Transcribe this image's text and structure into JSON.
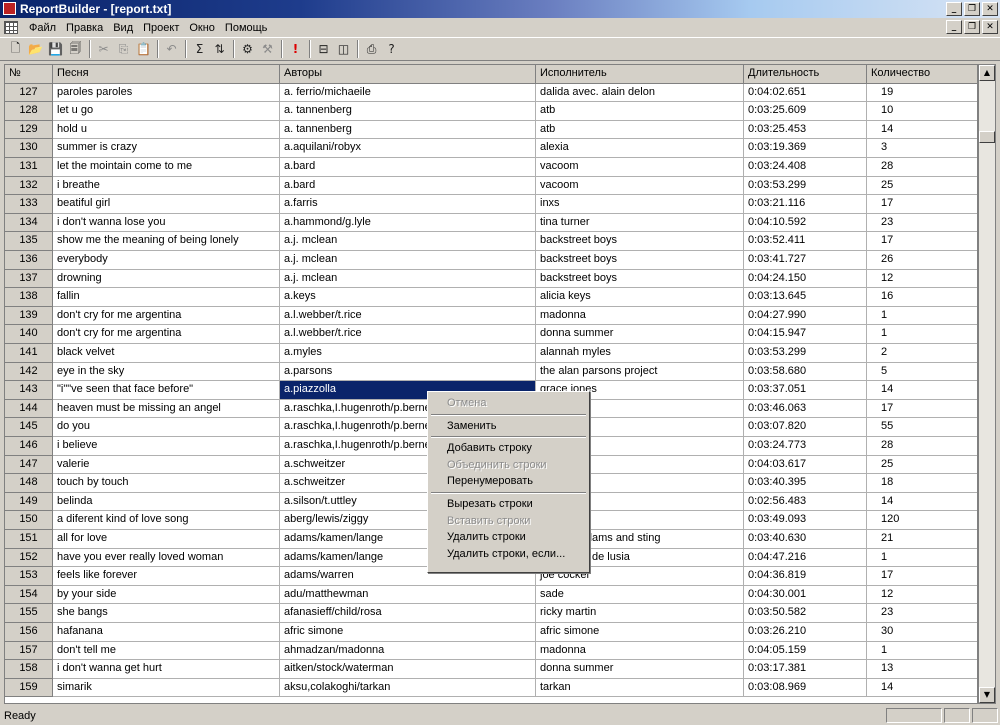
{
  "window": {
    "title": "ReportBuilder - [report.txt]"
  },
  "menu": [
    "Файл",
    "Правка",
    "Вид",
    "Проект",
    "Окно",
    "Помощь"
  ],
  "toolbar": [
    {
      "icon": "new-icon",
      "glyph": "🗋"
    },
    {
      "icon": "open-icon",
      "glyph": "📂"
    },
    {
      "icon": "save-icon",
      "glyph": "💾"
    },
    {
      "icon": "save-all-icon",
      "glyph": "🗐"
    },
    {
      "sep": true
    },
    {
      "icon": "cut-icon",
      "glyph": "✂",
      "disabled": true
    },
    {
      "icon": "copy-icon",
      "glyph": "⎘",
      "disabled": true
    },
    {
      "icon": "paste-icon",
      "glyph": "📋",
      "disabled": true
    },
    {
      "sep": true
    },
    {
      "icon": "undo-icon",
      "glyph": "↶",
      "disabled": true
    },
    {
      "sep": true
    },
    {
      "icon": "sum-icon",
      "glyph": "Σ"
    },
    {
      "icon": "sort-icon",
      "glyph": "⇅"
    },
    {
      "sep": true
    },
    {
      "icon": "filter-icon",
      "glyph": "⚙"
    },
    {
      "icon": "tools-icon",
      "glyph": "⚒",
      "disabled": true
    },
    {
      "sep": true
    },
    {
      "icon": "alert-icon",
      "glyph": "!",
      "red": true
    },
    {
      "sep": true
    },
    {
      "icon": "split-horizontal-icon",
      "glyph": "⊟"
    },
    {
      "icon": "split-vertical-icon",
      "glyph": "◫"
    },
    {
      "sep": true
    },
    {
      "icon": "print-icon",
      "glyph": "⎙"
    },
    {
      "icon": "help-icon",
      "glyph": "?"
    }
  ],
  "grid": {
    "headers": [
      "№",
      "Песня",
      "Авторы",
      "Исполнитель",
      "Длительность",
      "Количество"
    ],
    "rows": [
      [
        "127",
        "paroles paroles",
        "a. ferrio/michaeile",
        "dalida avec. alain delon",
        "0:04:02.651",
        "19"
      ],
      [
        "128",
        "let u go",
        "a. tannenberg",
        "atb",
        "0:03:25.609",
        "10"
      ],
      [
        "129",
        "hold u",
        "a. tannenberg",
        "atb",
        "0:03:25.453",
        "14"
      ],
      [
        "130",
        "summer is crazy",
        "a.aquilani/robyx",
        "alexia",
        "0:03:19.369",
        "3"
      ],
      [
        "131",
        "let the mointain come to me",
        "a.bard",
        "vacoom",
        "0:03:24.408",
        "28"
      ],
      [
        "132",
        "i breathe",
        "a.bard",
        "vacoom",
        "0:03:53.299",
        "25"
      ],
      [
        "133",
        "beatiful girl",
        "a.farris",
        "inxs",
        "0:03:21.116",
        "17"
      ],
      [
        "134",
        "i don't wanna lose you",
        "a.hammond/g.lyle",
        "tina turner",
        "0:04:10.592",
        "23"
      ],
      [
        "135",
        "show me the meaning of being lonely",
        "a.j. mclean",
        "backstreet boys",
        "0:03:52.411",
        "17"
      ],
      [
        "136",
        "everybody",
        "a.j. mclean",
        "backstreet boys",
        "0:03:41.727",
        "26"
      ],
      [
        "137",
        "drowning",
        "a.j. mclean",
        "backstreet boys",
        "0:04:24.150",
        "12"
      ],
      [
        "138",
        "fallin",
        "a.keys",
        "alicia keys",
        "0:03:13.645",
        "16"
      ],
      [
        "139",
        "don't cry for me argentina",
        "a.l.webber/t.rice",
        "madonna",
        "0:04:27.990",
        "1"
      ],
      [
        "140",
        "don't cry for me argentina",
        "a.l.webber/t.rice",
        "donna summer",
        "0:04:15.947",
        "1"
      ],
      [
        "141",
        "black velvet",
        "a.myles",
        "alannah myles",
        "0:03:53.299",
        "2"
      ],
      [
        "142",
        "eye in the sky",
        "a.parsons",
        "the alan parsons project",
        "0:03:58.680",
        "5"
      ],
      [
        "143",
        "\"i\"\"ve seen that face before\"",
        "a.piazzolla",
        "grace jones",
        "0:03:37.051",
        "14"
      ],
      [
        "144",
        "heaven must be missing an angel",
        "a.raschka,I.hugenroth/p.berne",
        "",
        "0:03:46.063",
        "17"
      ],
      [
        "145",
        "do you",
        "a.raschka,I.hugenroth/p.berne",
        "",
        "0:03:07.820",
        "55"
      ],
      [
        "146",
        "i believe",
        "a.raschka,I.hugenroth/p.berne",
        "",
        "0:03:24.773",
        "28"
      ],
      [
        "147",
        "valerie",
        "a.schweitzer",
        "",
        "0:04:03.617",
        "25"
      ],
      [
        "148",
        "touch by touch",
        "a.schweitzer",
        "",
        "0:03:40.395",
        "18"
      ],
      [
        "149",
        "belinda",
        "a.silson/t.uttley",
        "",
        "0:02:56.483",
        "14"
      ],
      [
        "150",
        "a diferent kind of love song",
        "aberg/lewis/ziggy",
        "",
        "0:03:49.093",
        "120"
      ],
      [
        "151",
        "all for love",
        "adams/kamen/lange",
        "t, bryan adams and sting",
        "0:03:40.630",
        "21"
      ],
      [
        "152",
        "have you ever really loved woman",
        "adams/kamen/lange",
        "ns & paco de lusia",
        "0:04:47.216",
        "1"
      ],
      [
        "153",
        "feels like forever",
        "adams/warren",
        "joe cocker",
        "0:04:36.819",
        "17"
      ],
      [
        "154",
        "by your side",
        "adu/matthewman",
        "sade",
        "0:04:30.001",
        "12"
      ],
      [
        "155",
        "she bangs",
        "afanasieff/child/rosa",
        "ricky martin",
        "0:03:50.582",
        "23"
      ],
      [
        "156",
        "hafanana",
        "afric simone",
        "afric simone",
        "0:03:26.210",
        "30"
      ],
      [
        "157",
        "don't tell me",
        "ahmadzan/madonna",
        "madonna",
        "0:04:05.159",
        "1"
      ],
      [
        "158",
        "i don't wanna get hurt",
        "aitken/stock/waterman",
        "donna summer",
        "0:03:17.381",
        "13"
      ],
      [
        "159",
        "simarik",
        "aksu,colakoghi/tarkan",
        "tarkan",
        "0:03:08.969",
        "14"
      ]
    ]
  },
  "context_menu": [
    {
      "label": "Отмена",
      "disabled": true
    },
    {
      "sep": true
    },
    {
      "label": "Заменить"
    },
    {
      "sep": true
    },
    {
      "label": "Добавить строку"
    },
    {
      "label": "Объединить строки",
      "disabled": true
    },
    {
      "label": "Перенумеровать"
    },
    {
      "sep": true
    },
    {
      "label": "Вырезать строки"
    },
    {
      "label": "Вставить строки",
      "disabled": true
    },
    {
      "label": "Удалить строки"
    },
    {
      "label": "Удалить строки, если..."
    }
  ],
  "status": {
    "text": "Ready"
  }
}
